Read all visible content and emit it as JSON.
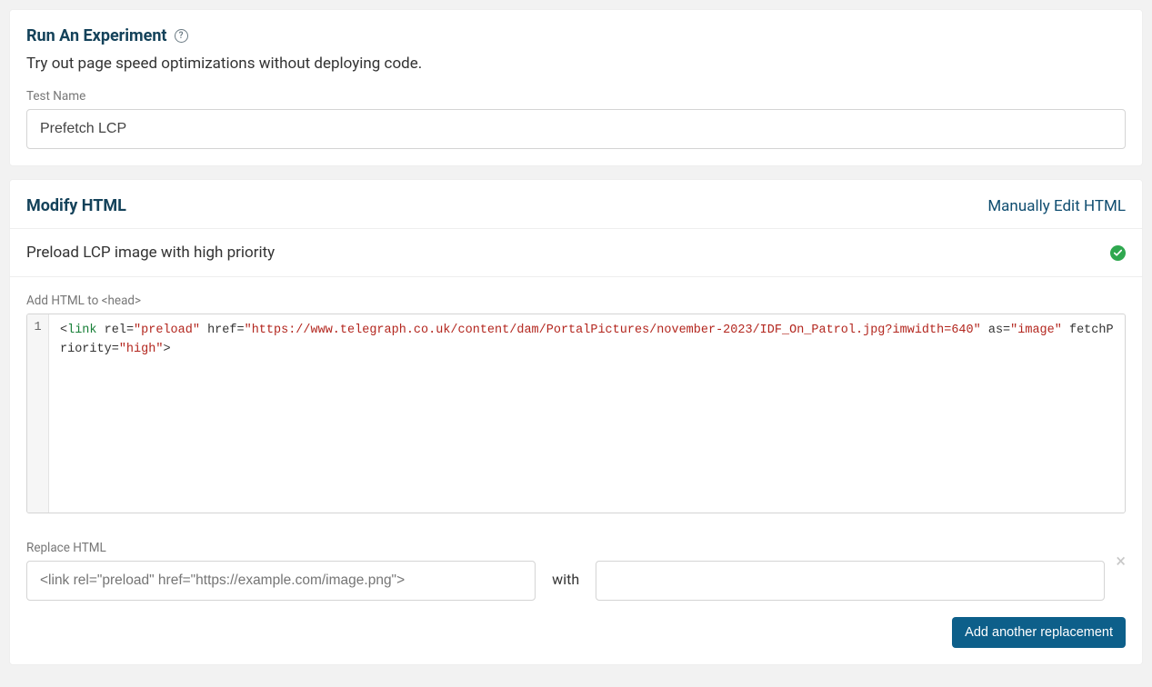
{
  "experiment": {
    "title": "Run An Experiment",
    "subtitle": "Try out page speed optimizations without deploying code.",
    "test_name_label": "Test Name",
    "test_name_value": "Prefetch LCP"
  },
  "modify": {
    "title": "Modify HTML",
    "manual_link": "Manually Edit HTML",
    "rule_title": "Preload LCP image with high priority",
    "add_label": "Add HTML to <head>",
    "code": {
      "line_no": "1",
      "tag": "link",
      "rel_attr": "rel",
      "rel_val": "\"preload\"",
      "href_attr": "href",
      "href_val": "\"https://www.telegraph.co.uk/content/dam/PortalPictures/november-2023/IDF_On_Patrol.jpg?imwidth=640\"",
      "as_attr": "as",
      "as_val": "\"image\"",
      "fp_attr": "fetchPriority",
      "fp_val": "\"high\""
    },
    "replace_label": "Replace HTML",
    "replace_placeholder": "<link rel=\"preload\" href=\"https://example.com/image.png\">",
    "with_label": "with",
    "replace_with_value": "",
    "add_btn": "Add another replacement"
  }
}
